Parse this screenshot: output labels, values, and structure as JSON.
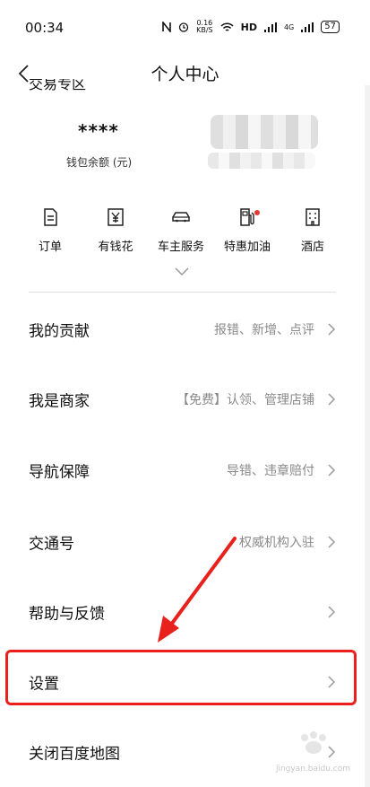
{
  "status": {
    "time": "00:34",
    "net_speed_value": "0.16",
    "net_speed_unit": "KB/S",
    "hd_label": "HD",
    "net_label": "4G",
    "battery": "57"
  },
  "nav": {
    "title": "个人中心"
  },
  "wallet": {
    "section_title": "交易专区",
    "value": "****",
    "label": "钱包余额 (元)"
  },
  "services": [
    {
      "label": "订单",
      "icon": "document-icon"
    },
    {
      "label": "有钱花",
      "icon": "yen-icon"
    },
    {
      "label": "车主服务",
      "icon": "car-icon"
    },
    {
      "label": "特惠加油",
      "icon": "fuel-icon",
      "badge": true
    },
    {
      "label": "酒店",
      "icon": "hotel-icon"
    }
  ],
  "menu": [
    {
      "label": "我的贡献",
      "desc": "报错、新增、点评"
    },
    {
      "label": "我是商家",
      "desc": "【免费】认领、管理店铺"
    },
    {
      "label": "导航保障",
      "desc": "导错、违章赔付"
    },
    {
      "label": "交通号",
      "desc": "权威机构入驻"
    },
    {
      "label": "帮助与反馈",
      "desc": ""
    },
    {
      "label": "设置",
      "desc": ""
    },
    {
      "label": "关闭百度地图",
      "desc": ""
    }
  ],
  "annotation_color": "#e8211d",
  "watermark": "jingyan.baidu.com"
}
